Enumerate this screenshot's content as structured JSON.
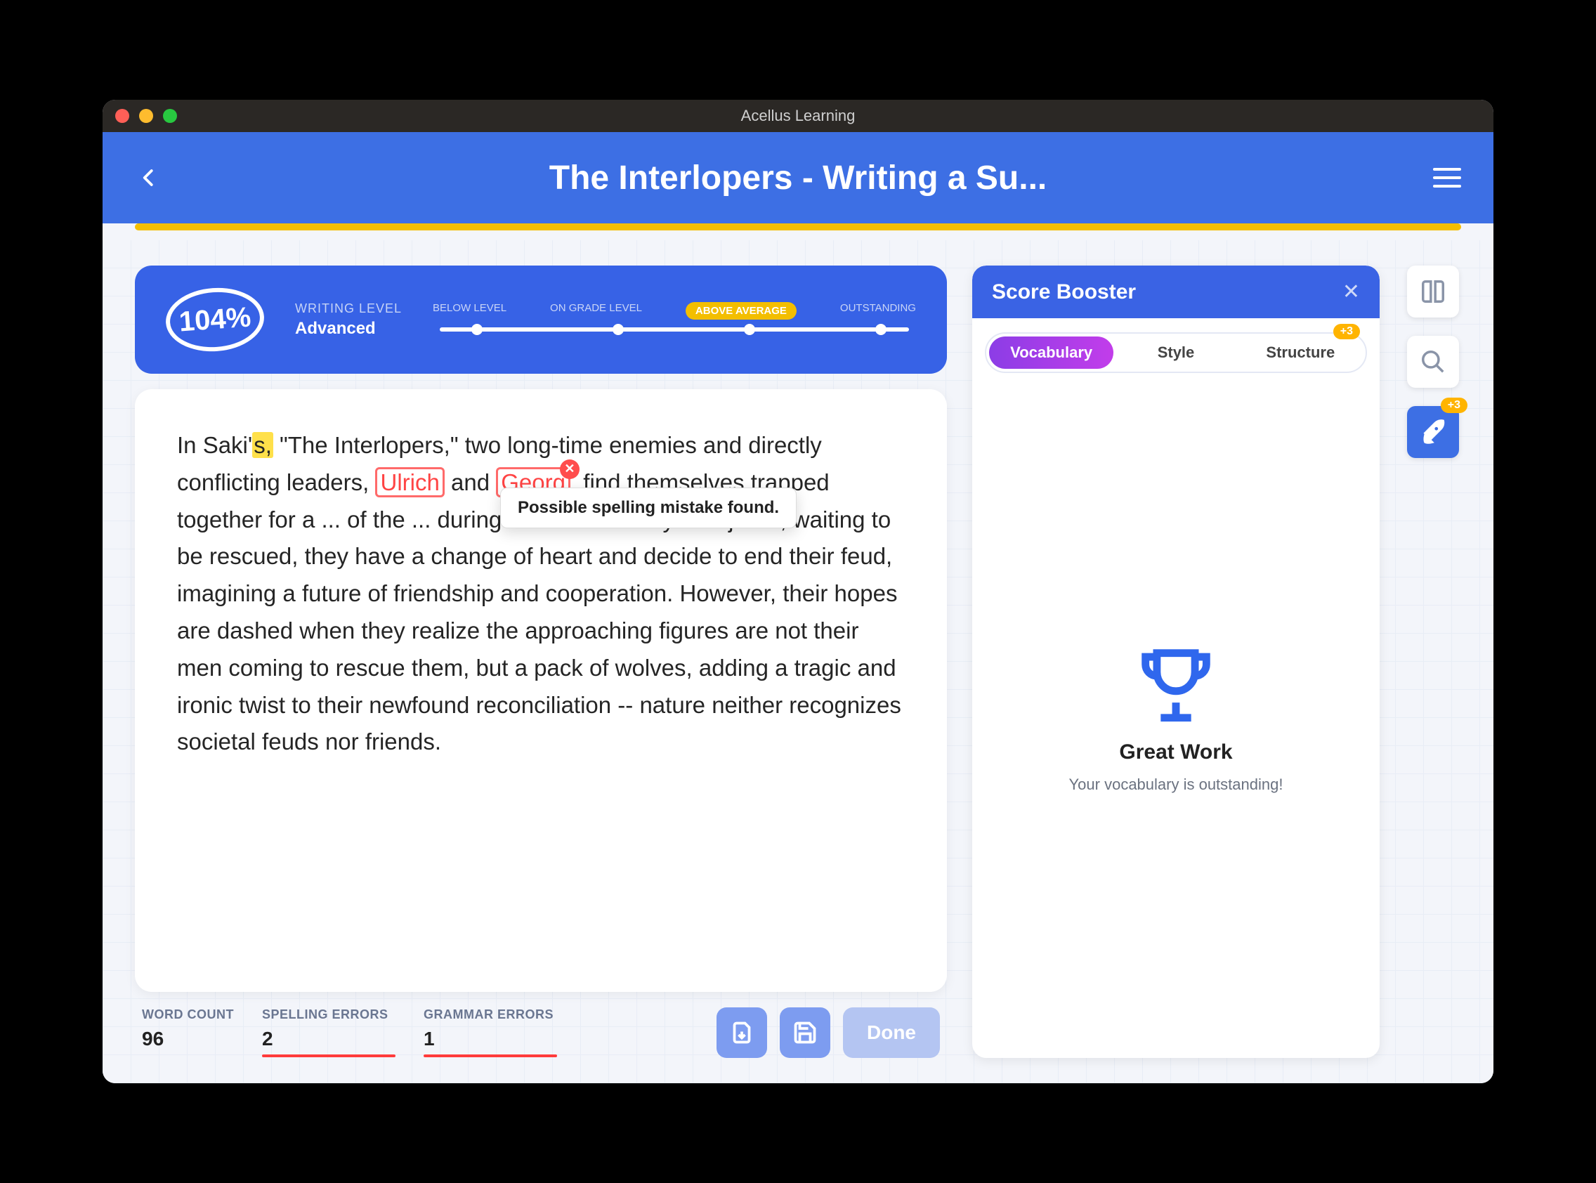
{
  "app_title": "Acellus Learning",
  "page_title": "The Interlopers - Writing a Su...",
  "writing_level": {
    "score": "104%",
    "label": "WRITING LEVEL",
    "value": "Advanced",
    "steps": [
      "BELOW LEVEL",
      "ON GRADE LEVEL",
      "ABOVE AVERAGE",
      "OUTSTANDING"
    ],
    "active_step": 2
  },
  "essay": {
    "pre": "In Saki'",
    "highlight": "s,",
    "post1": " \"The Interlopers,\" two long-time enemies and directly conflicting leaders, ",
    "err1": "Ulrich",
    "mid1": " and ",
    "err2": "Georg",
    "post2": ", find themselves trapped together for a ... of the ... during a storm. As they lie injured, waiting to be rescued, they have a change of heart and decide to end their feud, imagining a future of friendship and cooperation. However, their hopes are dashed when they realize the approaching figures are not their men coming to rescue them, but a pack of wolves, adding a tragic and ironic twist to their newfound reconciliation -- nature neither recognizes societal feuds nor friends."
  },
  "tooltip": "Possible spelling mistake found.",
  "stats": {
    "word_count_label": "WORD COUNT",
    "word_count": "96",
    "spelling_label": "SPELLING ERRORS",
    "spelling": "2",
    "grammar_label": "GRAMMAR ERRORS",
    "grammar": "1",
    "done": "Done"
  },
  "booster": {
    "title": "Score Booster",
    "tabs": {
      "vocab": "Vocabulary",
      "style": "Style",
      "structure": "Structure"
    },
    "structure_badge": "+3",
    "great": "Great Work",
    "sub": "Your vocabulary is outstanding!"
  },
  "tool_badge": "+3"
}
